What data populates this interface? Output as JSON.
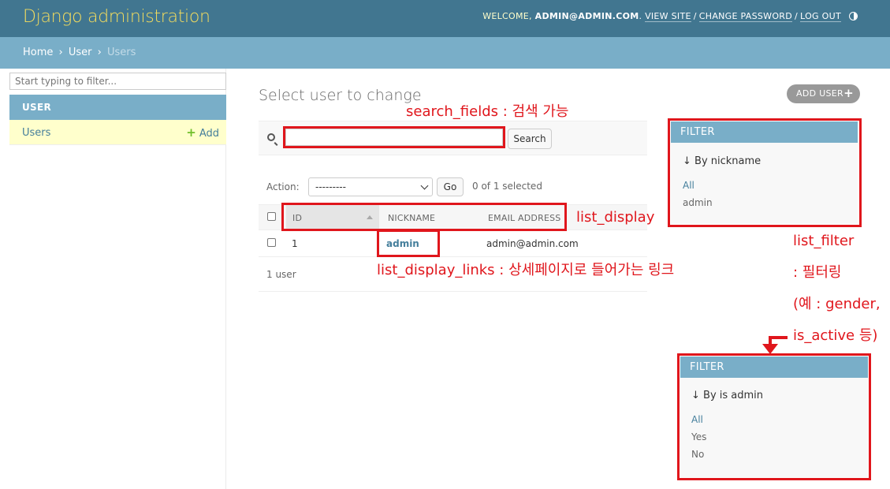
{
  "header": {
    "branding": "Django administration",
    "welcome": "WELCOME,",
    "user": "ADMIN@ADMIN.COM",
    "view_site": "VIEW SITE",
    "change_password": "CHANGE PASSWORD",
    "log_out": "LOG OUT",
    "theme_icon": "half-circle-icon"
  },
  "breadcrumbs": {
    "home": "Home",
    "app": "User",
    "current": "Users",
    "sep": "›"
  },
  "sidebar": {
    "filter_placeholder": "Start typing to filter...",
    "app_caption": "USER",
    "model_label": "Users",
    "add_label": "Add"
  },
  "main": {
    "title": "Select user to change",
    "add_button": "ADD USER",
    "search_button": "Search",
    "action_label": "Action:",
    "action_selected": "---------",
    "go_button": "Go",
    "counter": "0 of 1 selected",
    "columns": [
      "ID",
      "NICKNAME",
      "EMAIL ADDRESS"
    ],
    "rows": [
      {
        "id": "1",
        "nickname": "admin",
        "email": "admin@admin.com"
      }
    ],
    "paginator": "1 user"
  },
  "filters": [
    {
      "header": "FILTER",
      "by": "↓ By nickname",
      "items": [
        "All",
        "admin"
      ]
    },
    {
      "header": "FILTER",
      "by": "↓ By is admin",
      "items": [
        "All",
        "Yes",
        "No"
      ]
    }
  ],
  "annotations": {
    "search_fields": "search_fields : 검색 가능",
    "list_display": "list_display",
    "list_display_links": "list_display_links : 상세페이지로 들어가는 링크",
    "list_filter_1": "list_filter",
    "list_filter_2": ": 필터링",
    "list_filter_3": "(예 : gender,",
    "list_filter_4": "is_active 등)"
  },
  "colors": {
    "header": "#417690",
    "breadcrumbs": "#79aec8",
    "branding": "#f5dd5d",
    "annotation_red": "#e0161c",
    "selected_row": "#ffffcc"
  }
}
